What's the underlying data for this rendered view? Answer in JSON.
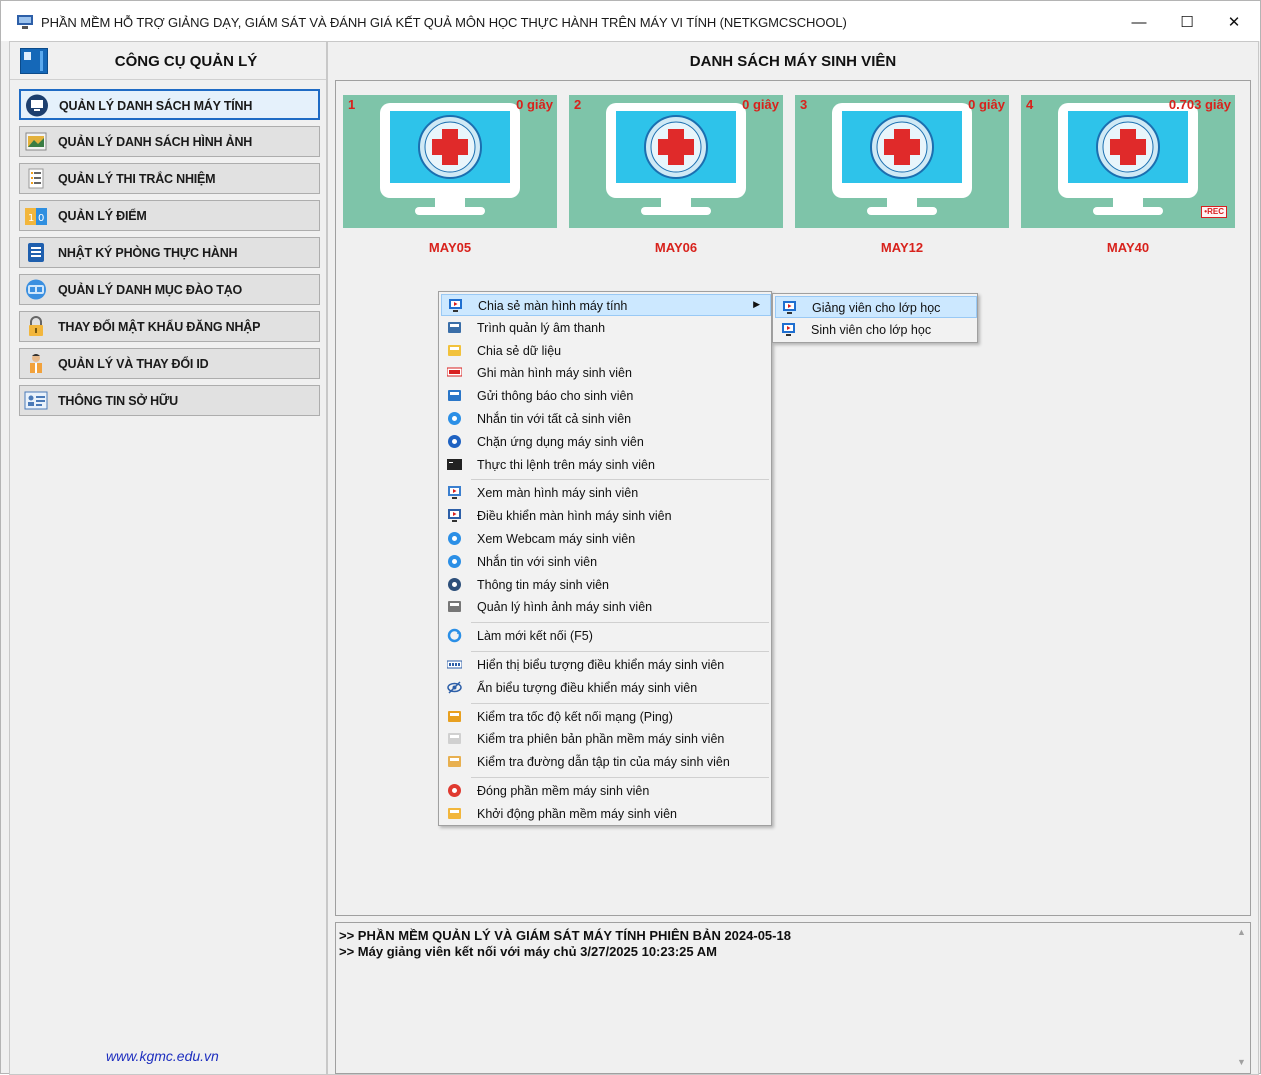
{
  "window": {
    "title": "PHẦN MỀM HỖ TRỢ GIẢNG DẠY, GIÁM SÁT VÀ ĐÁNH GIÁ KẾT QUẢ MÔN HỌC THỰC HÀNH TRÊN MÁY VI TÍNH (NETKGMCSCHOOL)",
    "minimize": "—",
    "maximize": "☐",
    "close": "✕"
  },
  "left": {
    "title": "CÔNG CỤ QUẢN LÝ",
    "website": "www.kgmc.edu.vn",
    "items": [
      {
        "label": "QUẢN LÝ DANH SÁCH MÁY TÍNH",
        "icon": "monitor-icon"
      },
      {
        "label": "QUẢN LÝ DANH SÁCH HÌNH ẢNH",
        "icon": "image-icon"
      },
      {
        "label": "QUẢN LÝ THI TRẮC NHIỆM",
        "icon": "checklist-icon"
      },
      {
        "label": "QUẢN LÝ ĐIỂM",
        "icon": "score-icon"
      },
      {
        "label": "NHẬT KÝ PHÒNG THỰC HÀNH",
        "icon": "log-icon"
      },
      {
        "label": "QUẢN LÝ DANH MỤC ĐÀO TẠO",
        "icon": "catalog-icon"
      },
      {
        "label": "THAY ĐỔI MẬT KHẨU ĐĂNG NHẬP",
        "icon": "lock-icon"
      },
      {
        "label": "QUẢN LÝ VÀ THAY ĐỔI ID",
        "icon": "user-id-icon"
      },
      {
        "label": "THÔNG TIN SỞ HỮU",
        "icon": "info-card-icon"
      }
    ]
  },
  "right": {
    "title": "DANH SÁCH MÁY SINH VIÊN",
    "computers": [
      {
        "num": "1",
        "time": "0 giây",
        "name": "MAY05",
        "rec": ""
      },
      {
        "num": "2",
        "time": "0 giây",
        "name": "MAY06",
        "rec": ""
      },
      {
        "num": "3",
        "time": "0 giây",
        "name": "MAY12",
        "rec": ""
      },
      {
        "num": "4",
        "time": "0.703 giây",
        "name": "MAY40",
        "rec": "•REC"
      }
    ],
    "log": [
      ">> PHẦN MỀM QUẢN LÝ VÀ GIÁM SÁT MÁY TÍNH PHIÊN BẢN 2024-05-18",
      ">> Máy giảng viên kết nối với máy chủ 3/27/2025 10:23:25 AM"
    ]
  },
  "context_menu": {
    "items": [
      {
        "label": "Chia sẻ màn hình máy tính",
        "icon": "share-screen-icon",
        "has_submenu": true,
        "highlighted": true,
        "arrow": "▶"
      },
      {
        "label": "Trình quản lý âm thanh",
        "icon": "audio-manager-icon"
      },
      {
        "label": "Chia sẻ dữ liệu",
        "icon": "folder-share-icon"
      },
      {
        "label": "Ghi màn hình máy sinh viên",
        "icon": "record-icon"
      },
      {
        "label": "Gửi thông báo cho sinh viên",
        "icon": "broadcast-icon"
      },
      {
        "label": "Nhắn tin với tất cả sinh viên",
        "icon": "chat-all-icon"
      },
      {
        "label": "Chặn ứng dụng máy sinh viên",
        "icon": "block-app-icon"
      },
      {
        "label": "Thực thi lệnh trên máy sinh viên",
        "icon": "terminal-icon"
      },
      {
        "label": "Xem màn hình máy sinh viên",
        "icon": "view-screen-icon",
        "sep_before": true
      },
      {
        "label": "Điều khiển màn hình máy sinh viên",
        "icon": "remote-control-icon"
      },
      {
        "label": "Xem Webcam máy sinh viên",
        "icon": "webcam-icon"
      },
      {
        "label": "Nhắn tin với sinh viên",
        "icon": "chat-icon"
      },
      {
        "label": "Thông tin máy sinh viên",
        "icon": "pc-info-icon"
      },
      {
        "label": "Quản lý hình ảnh máy sinh viên",
        "icon": "image-manager-icon"
      },
      {
        "label": "Làm mới kết nối (F5)",
        "icon": "refresh-icon",
        "sep_before": true
      },
      {
        "label": "Hiển thị biểu tượng điều khiển máy sinh viên",
        "icon": "show-icon",
        "sep_before": true
      },
      {
        "label": "Ẩn biểu tượng điều khiển máy sinh viên",
        "icon": "hide-icon"
      },
      {
        "label": "Kiểm tra tốc độ kết nối mạng (Ping)",
        "icon": "ping-icon",
        "sep_before": true
      },
      {
        "label": "Kiểm tra phiên bản phần mềm máy sinh viên",
        "icon": "version-icon"
      },
      {
        "label": "Kiểm tra đường dẫn tập tin của máy sinh viên",
        "icon": "path-icon"
      },
      {
        "label": "Đóng phần mềm máy sinh viên",
        "icon": "power-icon",
        "sep_before": true
      },
      {
        "label": "Khởi động phần mềm máy sinh viên",
        "icon": "start-icon"
      }
    ],
    "submenu": [
      {
        "label": "Giảng viên cho lớp học",
        "icon": "teacher-screen-icon",
        "highlighted": true
      },
      {
        "label": "Sinh viên cho lớp học",
        "icon": "student-screen-icon"
      }
    ]
  }
}
